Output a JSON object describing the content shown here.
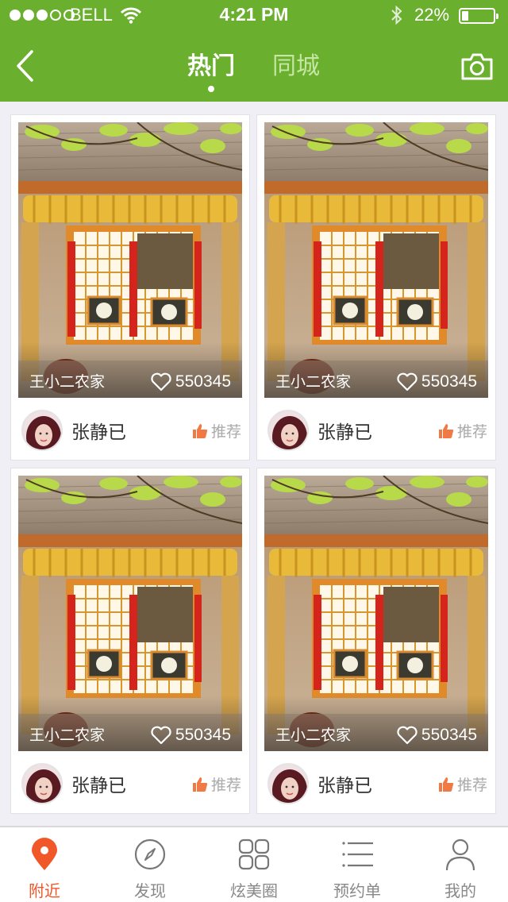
{
  "status_bar": {
    "carrier": "BELL",
    "time": "4:21 PM",
    "battery_percent": "22%",
    "battery_level": 0.22,
    "signal_bars_filled": 3,
    "signal_bars_total": 5
  },
  "nav": {
    "back_icon": "chevron-left-icon",
    "tabs": [
      {
        "label": "热门",
        "active": true
      },
      {
        "label": "同城",
        "active": false
      }
    ],
    "camera_icon": "camera-icon"
  },
  "colors": {
    "header_green": "#6aaf2d",
    "accent_orange": "#f0582a",
    "background": "#f0eff5"
  },
  "cards": [
    {
      "place": "王小二农家",
      "likes": "550345",
      "user": "张静已",
      "recommend": "推荐"
    },
    {
      "place": "王小二农家",
      "likes": "550345",
      "user": "张静已",
      "recommend": "推荐"
    },
    {
      "place": "王小二农家",
      "likes": "550345",
      "user": "张静已",
      "recommend": "推荐"
    },
    {
      "place": "王小二农家",
      "likes": "550345",
      "user": "张静已",
      "recommend": "推荐"
    }
  ],
  "tabbar": {
    "items": [
      {
        "label": "附近",
        "icon": "location-pin-icon",
        "active": true
      },
      {
        "label": "发现",
        "icon": "compass-icon",
        "active": false
      },
      {
        "label": "炫美圈",
        "icon": "grid-icon",
        "active": false
      },
      {
        "label": "预约单",
        "icon": "list-icon",
        "active": false
      },
      {
        "label": "我的",
        "icon": "user-icon",
        "active": false
      }
    ]
  }
}
